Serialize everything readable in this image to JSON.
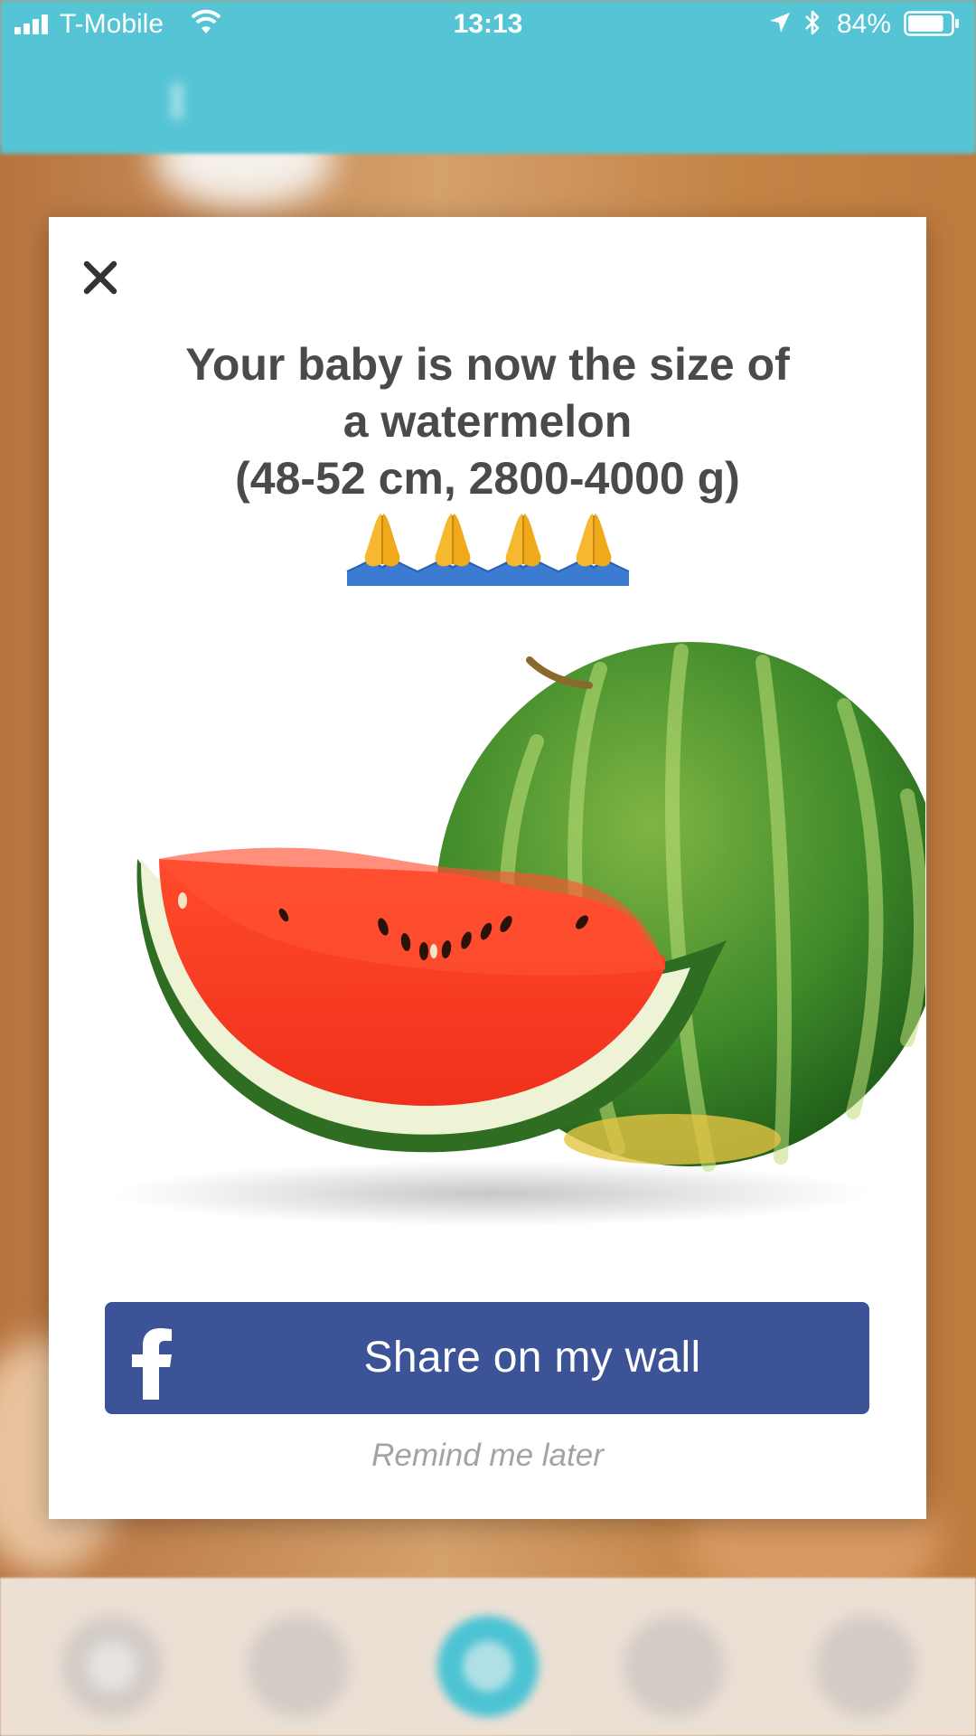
{
  "status_bar": {
    "carrier": "T-Mobile",
    "time": "13:13",
    "battery_percent": "84%",
    "battery_level": 0.84,
    "icons": [
      "signal-bars-icon",
      "wifi-icon",
      "location-arrow-icon",
      "bluetooth-icon",
      "battery-icon"
    ]
  },
  "modal": {
    "headline_lines": [
      "Your baby is now the size of",
      "a watermelon",
      "(48-52 cm, 2800-4000 g)"
    ],
    "emoji": [
      "🙏",
      "🙏",
      "🙏",
      "🙏"
    ],
    "image_subject": "watermelon",
    "share_button_label": "Share on my wall",
    "remind_label": "Remind me later",
    "close_icon": "close-icon",
    "share_icon": "facebook-icon"
  },
  "colors": {
    "header_teal": "#55c4d5",
    "facebook_blue": "#3c5497",
    "headline_text": "#4a4a4a",
    "remind_text": "#a3a3a3"
  }
}
